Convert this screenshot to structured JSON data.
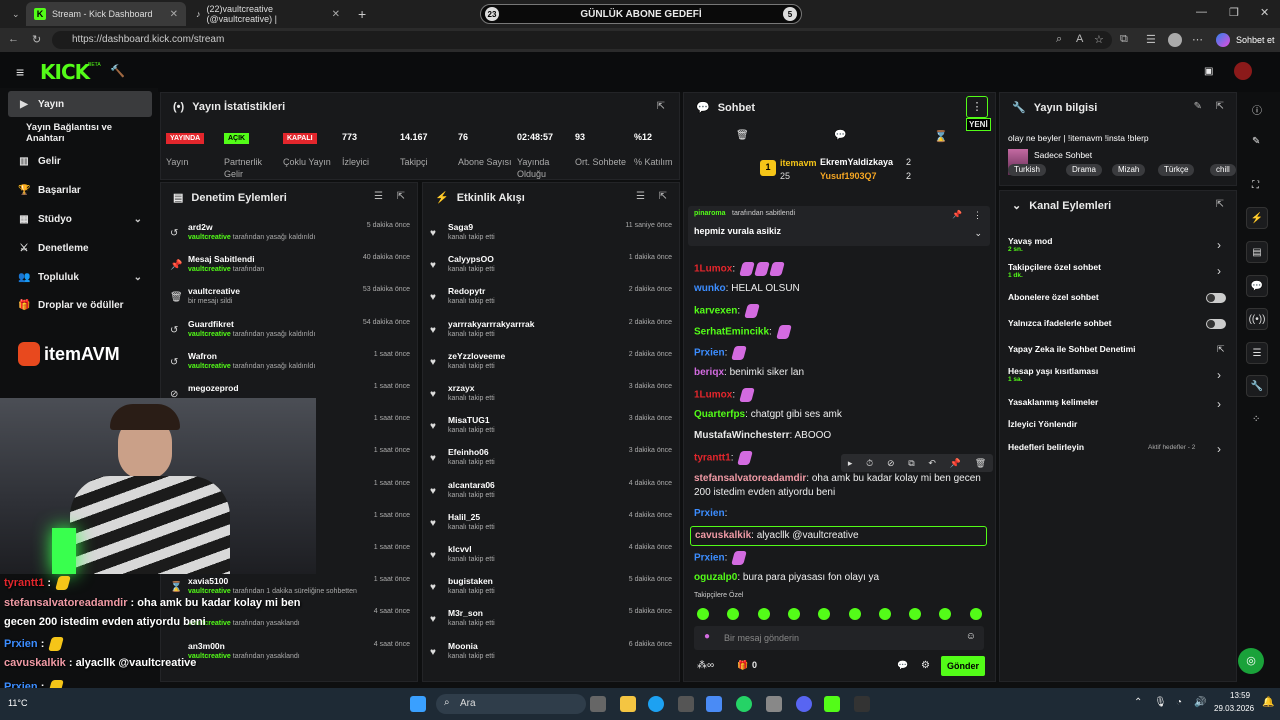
{
  "browser": {
    "tabs": [
      {
        "title": "Stream - Kick Dashboard"
      },
      {
        "title": "(22)vaultcreative (@vaultcreative) |"
      }
    ],
    "url": "https://dashboard.kick.com/stream",
    "goal": {
      "left": "23",
      "label": "GÜNLÜK ABONE GEDEFİ",
      "right": "5"
    },
    "profile_label": "Sohbet et"
  },
  "kick": {
    "logo": "KICK",
    "beta": "BETA"
  },
  "sidebar": {
    "items": [
      {
        "label": "Yayın",
        "icon": "video-icon"
      },
      {
        "label": "Yayın Bağlantısı ve Anahtarı",
        "icon": ""
      },
      {
        "label": "Gelir",
        "icon": "chart-icon"
      },
      {
        "label": "Başarılar",
        "icon": "trophy-icon"
      },
      {
        "label": "Stüdyo",
        "icon": "grid-icon"
      },
      {
        "label": "Denetleme",
        "icon": "sword-icon"
      },
      {
        "label": "Topluluk",
        "icon": "people-icon"
      },
      {
        "label": "Droplar ve ödüller",
        "icon": "gift-icon"
      }
    ],
    "sponsor": "itemAVM"
  },
  "stats": {
    "title": "Yayın İstatistikleri",
    "items": [
      {
        "value": "YAYINDA",
        "label": "Yayın",
        "badge": true,
        "color": "#e3262c"
      },
      {
        "value": "AÇIK",
        "label": "Partnerlik Gelir",
        "badge": true,
        "color": "#53fc18"
      },
      {
        "value": "KAPALI",
        "label": "Çoklu Yayın",
        "badge": true,
        "color": "#e3262c"
      },
      {
        "value": "773",
        "label": "İzleyici"
      },
      {
        "value": "14.167",
        "label": "Takipçi"
      },
      {
        "value": "76",
        "label": "Abone Sayısı"
      },
      {
        "value": "02:48:57",
        "label": "Yayında Olduğu"
      },
      {
        "value": "93",
        "label": "Ort. Sohbete"
      },
      {
        "value": "%12",
        "label": "% Katılım"
      }
    ]
  },
  "moderation": {
    "title": "Denetim Eylemleri",
    "rows": [
      {
        "name": "ard2w",
        "by": "vaultcreative",
        "desc": "tarafından yasağı kaldırıldı",
        "time": "5 dakika önce",
        "icon": "undo-icon"
      },
      {
        "name": "Mesaj Sabitlendi",
        "by": "vaultcreative",
        "desc": "tarafından",
        "time": "40 dakika önce",
        "icon": "pin-icon"
      },
      {
        "name": "vaultcreative",
        "by": "",
        "desc": "bir mesajı sildi",
        "time": "53 dakika önce",
        "icon": "trash-icon"
      },
      {
        "name": "Guardfikret",
        "by": "vaultcreative",
        "desc": "tarafından yasağı kaldırıldı",
        "time": "54 dakika önce",
        "icon": "undo-icon"
      },
      {
        "name": "Wafron",
        "by": "vaultcreative",
        "desc": "tarafından yasağı kaldırıldı",
        "time": "1 saat önce",
        "icon": "undo-icon"
      },
      {
        "name": "megozeprod",
        "by": "",
        "desc": "",
        "time": "1 saat önce",
        "icon": "ban-icon"
      },
      {
        "name": "",
        "by": "",
        "desc": "",
        "time": "1 saat önce",
        "icon": ""
      },
      {
        "name": "",
        "by": "",
        "desc": "ıldı",
        "time": "1 saat önce",
        "icon": ""
      },
      {
        "name": "",
        "by": "",
        "desc": "",
        "time": "1 saat önce",
        "icon": ""
      },
      {
        "name": "",
        "by": "",
        "desc": "ıldı",
        "time": "1 saat önce",
        "icon": ""
      },
      {
        "name": "",
        "by": "",
        "desc": "ıldı",
        "time": "1 saat önce",
        "icon": ""
      },
      {
        "name": "xavia5100",
        "by": "vaultcreative",
        "desc": "tarafından 1 dakika süreliğine sohbetten",
        "time": "1 saat önce",
        "icon": "hourglass-icon"
      },
      {
        "name": "",
        "by": "vaultcreative",
        "desc": "tarafından yasaklandı",
        "time": "4 saat önce",
        "icon": ""
      },
      {
        "name": "an3m00n",
        "by": "vaultcreative",
        "desc": "tarafından yasaklandı",
        "time": "4 saat önce",
        "icon": ""
      }
    ]
  },
  "activity": {
    "title": "Etkinlik Akışı",
    "rows": [
      {
        "name": "Saga9",
        "desc": "kanalı takip etti",
        "time": "11 saniye önce"
      },
      {
        "name": "CalyypsOO",
        "desc": "kanalı takip etti",
        "time": "1 dakika önce"
      },
      {
        "name": "Redopytr",
        "desc": "kanalı takip etti",
        "time": "2 dakika önce"
      },
      {
        "name": "yarrrakyarrrakyarrrak",
        "desc": "kanalı takip etti",
        "time": "2 dakika önce"
      },
      {
        "name": "zeYzzloveeme",
        "desc": "kanalı takip etti",
        "time": "2 dakika önce"
      },
      {
        "name": "xrzayx",
        "desc": "kanalı takip etti",
        "time": "3 dakika önce"
      },
      {
        "name": "MisaTUG1",
        "desc": "kanalı takip etti",
        "time": "3 dakika önce"
      },
      {
        "name": "Efeinho06",
        "desc": "kanalı takip etti",
        "time": "3 dakika önce"
      },
      {
        "name": "alcantara06",
        "desc": "kanalı takip etti",
        "time": "4 dakika önce"
      },
      {
        "name": "Halil_25",
        "desc": "kanalı takip etti",
        "time": "4 dakika önce"
      },
      {
        "name": "klcvvl",
        "desc": "kanalı takip etti",
        "time": "4 dakika önce"
      },
      {
        "name": "bugistaken",
        "desc": "kanalı takip etti",
        "time": "5 dakika önce"
      },
      {
        "name": "M3r_son",
        "desc": "kanalı takip etti",
        "time": "5 dakika önce"
      },
      {
        "name": "Moonia",
        "desc": "kanalı takip etti",
        "time": "6 dakika önce"
      }
    ]
  },
  "chat": {
    "title": "Sohbet",
    "new_label": "YENİ",
    "top_gifter": {
      "name": "itemavm",
      "count": "25",
      "others": [
        {
          "name": "EkremYaldizkaya",
          "count": "2"
        },
        {
          "name": "Yusuf1903Q7",
          "count": "2"
        }
      ]
    },
    "pinned": {
      "by": "pinaroma",
      "label": "tarafından sabitlendi",
      "text": "hepmiz vurala asikiz"
    },
    "messages": [
      {
        "user": "1Lumox",
        "color": "#e3262c",
        "text": "",
        "emotes": 3
      },
      {
        "user": "wunko",
        "color": "#3c8dff",
        "text": "HELAL OLSUN",
        "emotes": 0
      },
      {
        "user": "karvexen",
        "color": "#53fc18",
        "text": "",
        "emotes": 1
      },
      {
        "user": "SerhatEmincikk",
        "color": "#53fc18",
        "text": "",
        "emotes": 1
      },
      {
        "user": "Prxien",
        "color": "#3c8dff",
        "text": "",
        "emotes": 1
      },
      {
        "user": "beriqx",
        "color": "#d36be0",
        "text": "benimki siker lan",
        "emotes": 0
      },
      {
        "user": "1Lumox",
        "color": "#e3262c",
        "text": "",
        "emotes": 1
      },
      {
        "user": "Quarterfps",
        "color": "#53fc18",
        "text": "chatgpt gibi ses amk",
        "emotes": 0
      },
      {
        "user": "MustafaWinchesterr",
        "color": "#e8e8e8",
        "text": "ABOOO",
        "emotes": 0
      },
      {
        "user": "tyrantt1",
        "color": "#e3262c",
        "text": "",
        "emotes": 1
      },
      {
        "user": "stefansalvatoreadamdir",
        "color": "#f09aa5",
        "text": "oha amk bu kadar kolay mi ben gecen 200 istedim evden atiyordu beni",
        "emotes": 0
      },
      {
        "user": "Prxien",
        "color": "#3c8dff",
        "text": "",
        "emotes": 0
      },
      {
        "user": "cavuskalkik",
        "color": "#f09aa5",
        "text": "alyacllk @vaultcreative",
        "emotes": 0
      },
      {
        "user": "Prxien",
        "color": "#3c8dff",
        "text": "",
        "emotes": 1
      },
      {
        "user": "oguzalp0",
        "color": "#53fc18",
        "text": "bura para piyasası fon olayı ya",
        "emotes": 0
      }
    ],
    "followers_only": "Takipçilere Özel",
    "input_placeholder": "Bir mesaj gönderin",
    "send": "Gönder",
    "counter": "0"
  },
  "info": {
    "title": "Yayın bilgisi",
    "stream_title": "olay ne beyler | !itemavm !insta !blerp",
    "category": "Sadece Sohbet",
    "tags": [
      "Turkish",
      "Drama",
      "Mizah",
      "Türkçe",
      "chill"
    ]
  },
  "channel_actions": {
    "title": "Kanal Eylemleri",
    "items": [
      {
        "label": "Yavaş mod",
        "sub": "2 sn.",
        "ctrl": "chev"
      },
      {
        "label": "Takipçilere özel sohbet",
        "sub": "1 dk.",
        "ctrl": "chev"
      },
      {
        "label": "Abonelere özel sohbet",
        "sub": "",
        "ctrl": "toggle"
      },
      {
        "label": "Yalnızca ifadelerle sohbet",
        "sub": "",
        "ctrl": "toggle"
      },
      {
        "label": "Yapay Zeka ile Sohbet Denetimi",
        "sub": "",
        "ctrl": "ext"
      },
      {
        "label": "Hesap yaşı kısıtlaması",
        "sub": "1 sa.",
        "ctrl": "chev"
      },
      {
        "label": "Yasaklanmış kelimeler",
        "sub": "",
        "ctrl": "chev"
      },
      {
        "label": "İzleyici Yönlendir",
        "sub": "",
        "ctrl": ""
      },
      {
        "label": "Hedefleri belirleyin",
        "sub": "",
        "ctrl": "chev",
        "extra": "Aktif hedefler - 2"
      }
    ]
  },
  "overlay_chat": [
    {
      "user": "tyrantt1",
      "color": "#e3262c",
      "text": ""
    },
    {
      "user": "stefansalvatoreadamdir",
      "color": "#f09aa5",
      "text": "oha amk bu kadar kolay mi ben"
    },
    {
      "user": "",
      "color": "#fff",
      "text": "gecen 200 istedim evden atiyordu beni"
    },
    {
      "user": "Prxien",
      "color": "#3c8dff",
      "text": ""
    },
    {
      "user": "cavuskalkik",
      "color": "#f09aa5",
      "text": "alyacllk @vaultcreative"
    },
    {
      "user": "Prxien",
      "color": "#3c8dff",
      "text": ""
    },
    {
      "user": "oguzalp0",
      "color": "#53fc18",
      "text": "bura para piyasası fon olayı ya"
    }
  ],
  "taskbar": {
    "search": "Ara",
    "weather": "11°C",
    "time": "13:59",
    "date": "29.03.2026"
  }
}
